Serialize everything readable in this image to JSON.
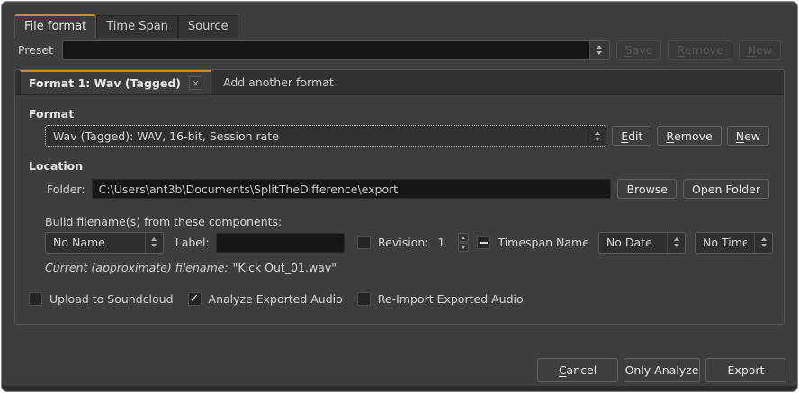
{
  "colors": {
    "accent": "#d6862c",
    "background": "#3d3d3d"
  },
  "outer_tabs": {
    "file_format": "File format",
    "time_span": "Time Span",
    "source": "Source"
  },
  "preset": {
    "label": "Preset",
    "value": "",
    "save": {
      "m": "S",
      "rest": "ave",
      "disabled": true
    },
    "remove": {
      "m": "R",
      "rest": "emove",
      "disabled": true
    },
    "new": {
      "m": "N",
      "rest": "ew",
      "disabled": true
    }
  },
  "format_notebook": {
    "active_tab": {
      "label": "Format 1: Wav (Tagged)",
      "close_glyph": "×"
    },
    "add_tab": {
      "label": "Add another format"
    }
  },
  "format": {
    "heading": "Format",
    "value": "Wav (Tagged): WAV, 16-bit, Session rate",
    "edit": {
      "m": "E",
      "rest": "dit"
    },
    "remove": {
      "m": "R",
      "rest": "emove"
    },
    "new": {
      "m": "N",
      "rest": "ew"
    }
  },
  "location": {
    "heading": "Location",
    "folder_label": "Folder:",
    "folder_value": "C:\\Users\\ant3b\\Documents\\SplitTheDifference\\export",
    "browse": "Browse",
    "open_folder": "Open Folder"
  },
  "filename": {
    "build_label": "Build filename(s) from these components:",
    "session_name": "No Name",
    "label_label": "Label:",
    "label_value": "",
    "revision_checked": false,
    "revision_label": "Revision:",
    "revision_value": "1",
    "timespan_checked": "mixed",
    "timespan_label": "Timespan Name",
    "date": "No Date",
    "time": "No Time",
    "current_label": "Current (approximate) filename:",
    "current_value": "\"Kick Out_01.wav\""
  },
  "options": {
    "soundcloud": {
      "label": "Upload to Soundcloud",
      "checked": false
    },
    "analyze": {
      "label": "Analyze Exported Audio",
      "checked": true
    },
    "reimport": {
      "label": "Re-Import Exported Audio",
      "checked": false
    }
  },
  "footer": {
    "cancel": {
      "m": "C",
      "rest": "ancel"
    },
    "only_analyze": "Only Analyze",
    "export": "Export"
  }
}
